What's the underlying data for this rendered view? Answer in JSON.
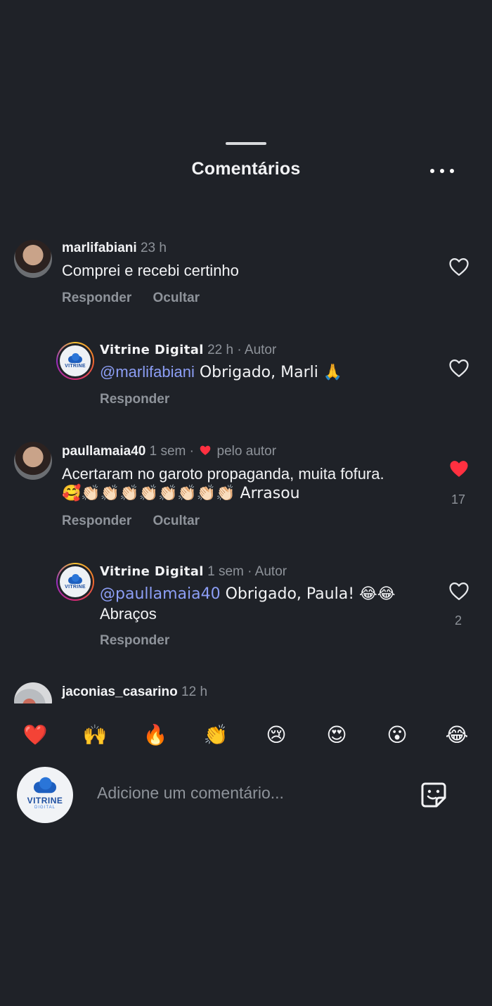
{
  "header": {
    "title": "Comentários"
  },
  "comments": [
    {
      "username": "marlifabiani",
      "time": "23 h",
      "text": "Comprei e recebi certinho",
      "actions": [
        "Responder",
        "Ocultar"
      ]
    },
    {
      "username": "Vitrine Digital",
      "time": "22 h",
      "role": "· Autor",
      "mention": "@marlifabiani",
      "text": " Obrigado, Marli 🙏",
      "actions": [
        "Responder"
      ]
    },
    {
      "username": "paullamaia40",
      "time": "1 sem",
      "liked_by_author": "pelo autor",
      "text_line1": "Acertaram no garoto propaganda, muita fofura.",
      "text_line2": "🥰👏🏻👏🏻👏🏻👏🏻👏🏻👏🏻👏🏻👏🏻 Arrasou",
      "like_count": "17",
      "actions": [
        "Responder",
        "Ocultar"
      ]
    },
    {
      "username": "Vitrine Digital",
      "time": "1 sem",
      "role": "· Autor",
      "mention": "@paullamaia40",
      "text_line1": " Obrigado, Paula! 😂😂",
      "text_line2": "Abraços",
      "like_count": "2",
      "actions": [
        "Responder"
      ]
    },
    {
      "username": "jaconias_casarino",
      "time": "12 h"
    }
  ],
  "reactions": [
    "❤️",
    "🙌",
    "🔥",
    "👏",
    "😢",
    "😍",
    "😮",
    "😂"
  ],
  "composer": {
    "placeholder": "Adicione um comentário...",
    "avatar_text": "VITRINE",
    "avatar_subtext": "DIGITAL",
    "logo_text": "VITRINE"
  },
  "colors": {
    "background": "#1f2228",
    "mention": "#8c9ef5",
    "liked_heart": "#ff3040",
    "muted_text": "#8e939a"
  },
  "icons": [
    "more-icon",
    "heart-outline-icon",
    "heart-filled-icon",
    "sticker-icon"
  ]
}
